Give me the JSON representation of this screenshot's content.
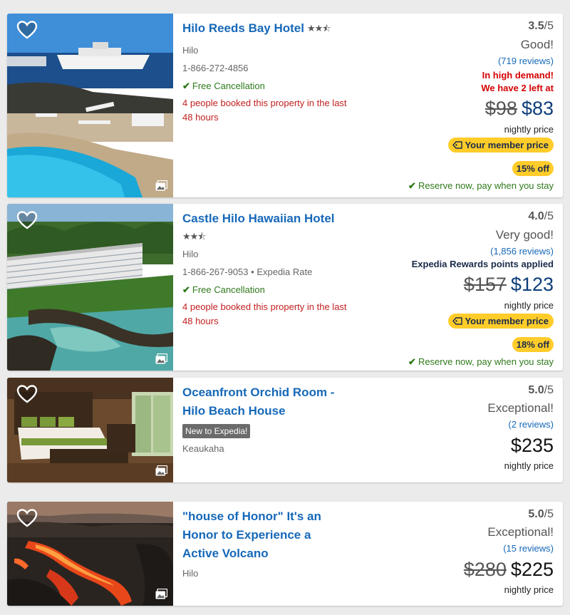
{
  "hotels": [
    {
      "name": "Hilo Reeds Bay Hotel",
      "stars": "★★⯪",
      "location": "Hilo",
      "phone": "1-866-272-4856",
      "cancellation": "Free Cancellation",
      "booked_notice": "4 people booked this property in the last 48 hours",
      "rating": "3.5",
      "rating_max": "/5",
      "rating_text": "Good!",
      "reviews": "(719 reviews)",
      "demand": "In high demand!",
      "left": "We have 2 left at",
      "old_price": "$98",
      "price": "$83",
      "nightly": "nightly price",
      "member_price": "Your member price",
      "discount": "15% off",
      "reserve": "Reserve now, pay when you stay"
    },
    {
      "name": "Castle Hilo Hawaiian Hotel",
      "stars": "★★⯪",
      "location": "Hilo",
      "phone": "1-866-267-9053",
      "rate_note": "Expedia Rate",
      "cancellation": "Free Cancellation",
      "booked_notice": "4 people booked this property in the last 48 hours",
      "rating": "4.0",
      "rating_max": "/5",
      "rating_text": "Very good!",
      "reviews": "(1,856 reviews)",
      "rewards": "Expedia Rewards points applied",
      "old_price": "$157",
      "price": "$123",
      "nightly": "nightly price",
      "member_price": "Your member price",
      "discount": "18% off",
      "reserve": "Reserve now, pay when you stay"
    },
    {
      "name_line1": "Oceanfront Orchid Room -",
      "name_line2": "Hilo Beach House",
      "badge": "New to Expedia!",
      "location": "Keaukaha",
      "rating": "5.0",
      "rating_max": "/5",
      "rating_text": "Exceptional!",
      "reviews": "(2 reviews)",
      "price": "$235",
      "nightly": "nightly price"
    },
    {
      "name_line1": "\"house of Honor\" It's an",
      "name_line2": "Honor to Experience a",
      "name_line3": "Active Volcano",
      "location": "Hilo",
      "rating": "5.0",
      "rating_max": "/5",
      "rating_text": "Exceptional!",
      "reviews": "(15 reviews)",
      "old_price": "$280",
      "price": "$225",
      "nightly": "nightly price"
    }
  ],
  "icons": {
    "favorite": "heart-outline-icon",
    "gallery": "gallery-icon",
    "check": "check-icon",
    "tag": "price-tag-icon"
  },
  "colors": {
    "link": "#1668b9",
    "alert": "#d40000",
    "success": "#2f7a1c",
    "member_badge": "#ffcc2a",
    "price": "#0d3d7a"
  }
}
